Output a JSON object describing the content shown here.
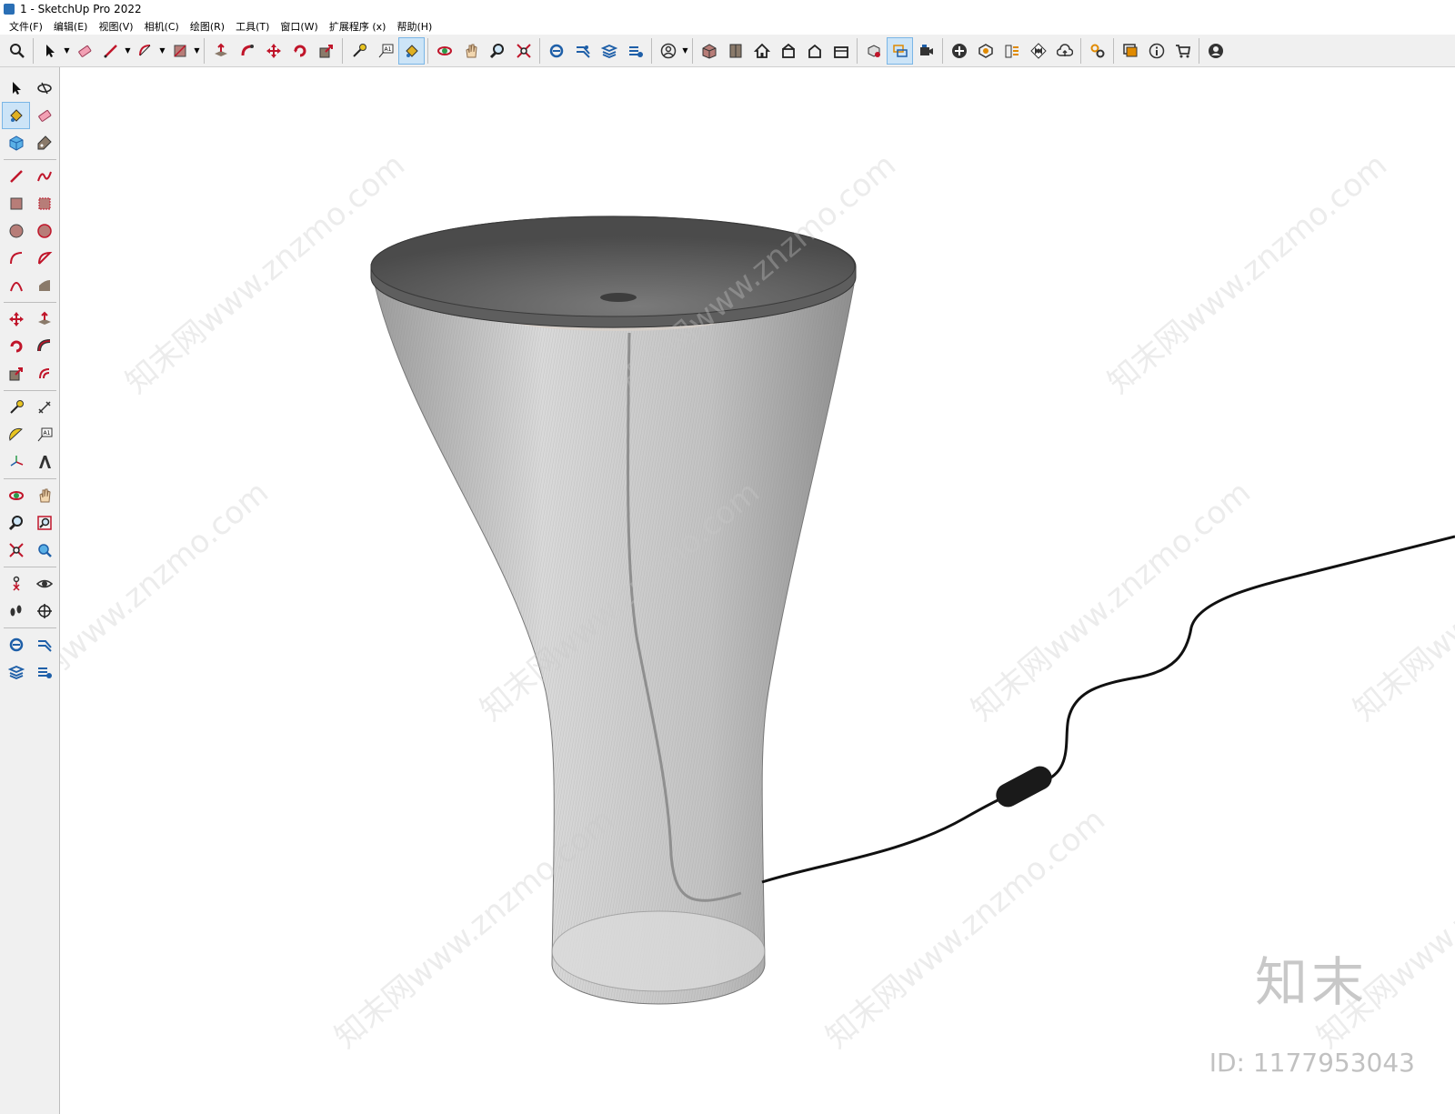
{
  "window": {
    "title": "1 - SketchUp Pro 2022"
  },
  "menu": {
    "items": [
      "文件(F)",
      "编辑(E)",
      "视图(V)",
      "相机(C)",
      "绘图(R)",
      "工具(T)",
      "窗口(W)",
      "扩展程序 (x)",
      "帮助(H)"
    ]
  },
  "toolbar": {
    "active_tool": "paint-bucket",
    "icons": [
      "search-icon",
      "select-icon",
      "eraser-icon",
      "pencil-icon",
      "arc-icon",
      "rectangle-icon",
      "push-pull-icon",
      "follow-me-icon",
      "move-icon",
      "rotate-icon",
      "scale-icon",
      "tape-measure-icon",
      "text-icon",
      "paint-bucket-icon",
      "orbit-icon",
      "pan-icon",
      "zoom-icon",
      "zoom-extents-icon",
      "section-icon",
      "section-display-icon",
      "section-fill-icon",
      "section-cut-icon",
      "account-icon",
      "warehouse-icon",
      "components-icon",
      "home-view-icon",
      "top-view-icon",
      "front-view-icon",
      "side-view-icon",
      "ruby-console-icon",
      "scenes-icon",
      "camera-icon",
      "add-icon",
      "styles-icon",
      "layers-icon",
      "checker-icon",
      "cloud-icon",
      "settings-icon",
      "comment-icon",
      "info-icon",
      "cart-icon",
      "profile-icon"
    ]
  },
  "sidebar": {
    "active_tool": "paint-bucket",
    "icons": [
      "select-icon",
      "orbit-icon",
      "paint-bucket-icon",
      "eraser-icon",
      "component-icon",
      "tag-icon",
      "pencil-icon",
      "freehand-icon",
      "rectangle-icon",
      "rotated-rectangle-icon",
      "circle-icon",
      "polygon-icon",
      "arc-icon",
      "pie-icon",
      "3-point-arc-icon",
      "2-point-arc-icon",
      "move-icon",
      "push-pull-icon",
      "rotate-icon",
      "follow-me-icon",
      "scale-icon",
      "offset-icon",
      "tape-measure-icon",
      "dimension-icon",
      "protractor-icon",
      "text-icon",
      "axes-icon",
      "3d-text-icon",
      "orbit-small-icon",
      "pan-icon",
      "zoom-icon",
      "zoom-window-icon",
      "zoom-extents-icon",
      "previous-view-icon",
      "position-camera-icon",
      "look-around-icon",
      "walk-icon",
      "section-plane-icon",
      "section-a-icon",
      "section-b-icon",
      "section-c-icon",
      "section-d-icon"
    ]
  },
  "viewport": {
    "model": "table-lamp",
    "colors": {
      "shade_top": "#5a5a5a",
      "shade_body": "#c8c8c8",
      "cord": "#111111"
    }
  },
  "watermark": {
    "repeat_text": "知末网www.znzmo.com",
    "logo": "知末",
    "id": "ID: 1177953043"
  }
}
